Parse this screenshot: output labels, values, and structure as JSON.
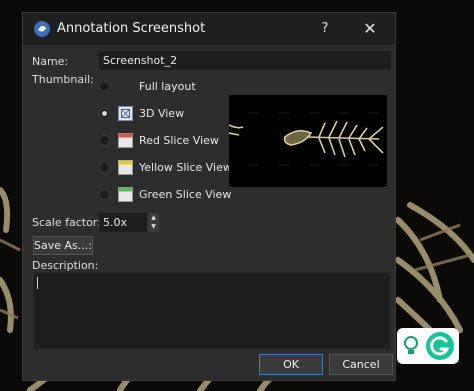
{
  "window": {
    "title": "Annotation Screenshot",
    "help_glyph": "?",
    "close_glyph": "✕"
  },
  "form": {
    "name_label": "Name:",
    "name_value": "Screenshot_2",
    "thumbnail_label": "Thumbnail:",
    "options": [
      {
        "label": "Full layout",
        "icon": "none",
        "checked": false
      },
      {
        "label": "3D View",
        "icon": "3d-view-icon",
        "checked": true
      },
      {
        "label": "Red Slice View",
        "icon": "red-slice-icon",
        "checked": false
      },
      {
        "label": "Yellow Slice View",
        "icon": "yellow-slice-icon",
        "checked": false
      },
      {
        "label": "Green Slice View",
        "icon": "green-slice-icon",
        "checked": false
      }
    ],
    "scale_label": "Scale factor:",
    "scale_value": "5.0x",
    "save_as_label": "Save As...:",
    "description_label": "Description:",
    "description_value": ""
  },
  "buttons": {
    "ok": "OK",
    "cancel": "Cancel"
  },
  "colors": {
    "accent": "#3f7fc0",
    "dialog_bg": "#2d2d2d",
    "widget_green": "#15c39a"
  }
}
